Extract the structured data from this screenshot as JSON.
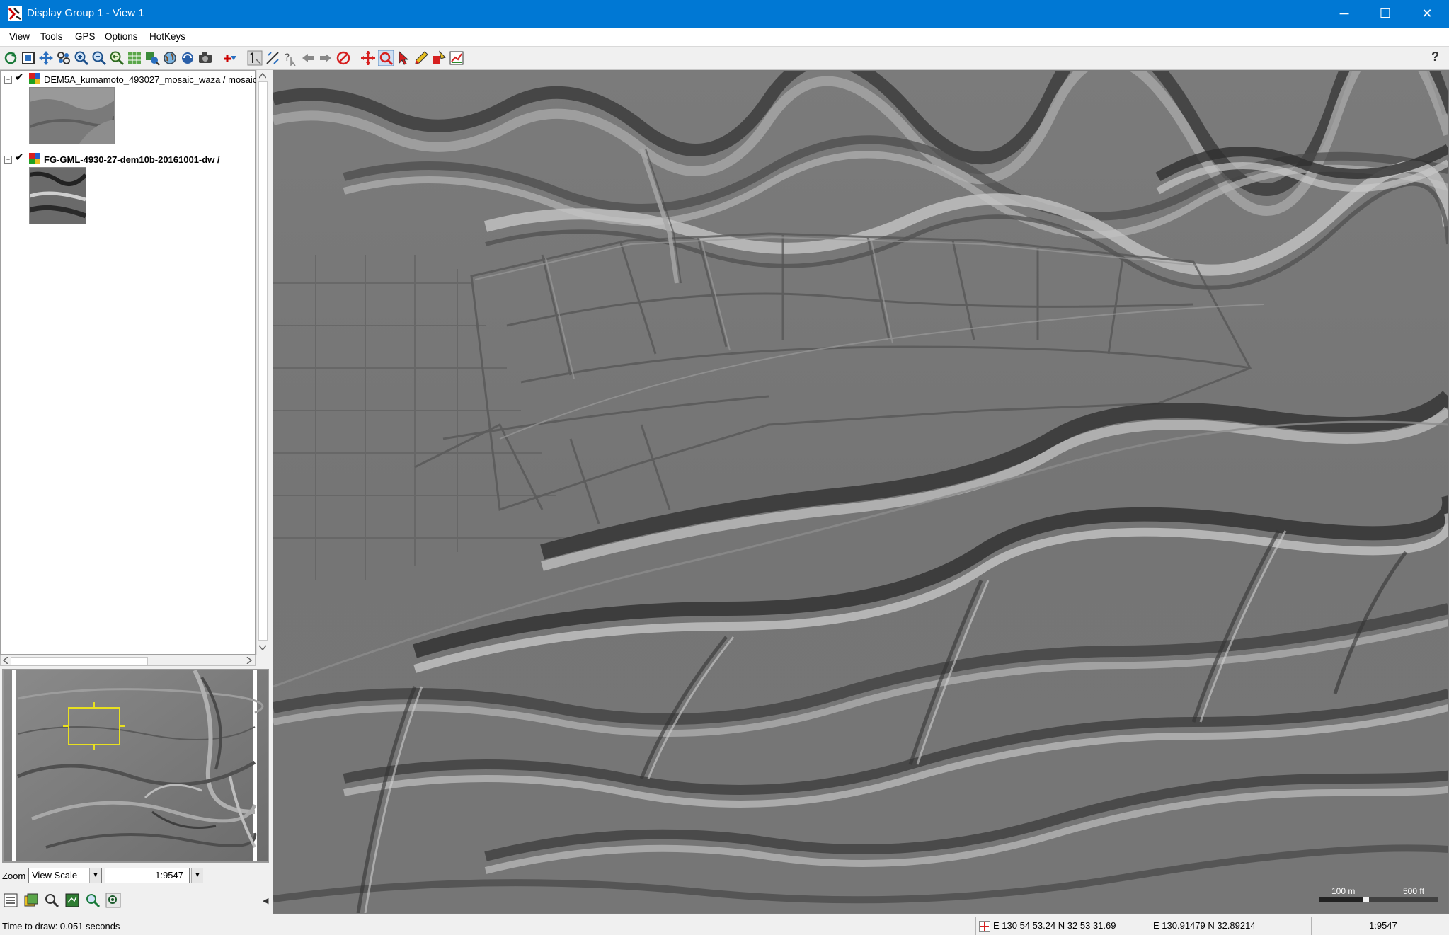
{
  "window": {
    "title": "Display Group 1 - View 1",
    "minimize_glyph": "─",
    "maximize_glyph": "☐",
    "close_glyph": "✕"
  },
  "menu": [
    "View",
    "Tools",
    "GPS",
    "Options",
    "HotKeys"
  ],
  "toolbar": {
    "icons": [
      "redraw-icon",
      "full-extent-icon",
      "pan-center-icon",
      "zoom-extent-icon",
      "zoom-in-icon",
      "zoom-out-icon",
      "zoom-previous-icon",
      "zoom-to-layer-icon",
      "zoom-selected-icon",
      "globe-icon",
      "spin-icon",
      "snapshot-icon",
      "add-layer-icon",
      "select-tool-icon",
      "measure-tool-icon",
      "help-query-icon",
      "back-icon",
      "forward-icon",
      "cancel-draw-icon",
      "crosshair-icon",
      "zoom-box-icon",
      "pointer-icon",
      "pencil-icon",
      "edit-tool-icon",
      "chart-icon"
    ],
    "selected_index": 20,
    "help_glyph": "?"
  },
  "layers": [
    {
      "name": "DEM5A_kumamoto_493027_mosaic_waza / mosaic",
      "checked": true,
      "expanded": true
    },
    {
      "name": "FG-GML-4930-27-dem10b-20161001-dw /",
      "checked": true,
      "expanded": true
    }
  ],
  "checkmark_glyph": "✔",
  "expander_glyph": "−",
  "zoom": {
    "label": "Zoom",
    "mode": "View Scale",
    "scale": "1:9547"
  },
  "bottom_icons": [
    "layer-list-icon",
    "layer-controls-icon",
    "zoom-lens-icon",
    "raster-view-icon",
    "zoom-refresh-icon",
    "magnify-icon"
  ],
  "collapse_arrow_glyph": "◀",
  "scalebar": {
    "metric": "100 m",
    "imperial": "500 ft"
  },
  "status": {
    "time_to_draw": "Time to draw: 0.051 seconds",
    "dms_coords": "E 130 54 53.24  N 32 53 31.69",
    "decimal_coords": "E 130.91479  N 32.89214",
    "scale": "1:9547"
  },
  "colors": {
    "titlebar": "#0078d4",
    "overview_box": "#e8e020",
    "window_bg": "#f0f0f0"
  }
}
